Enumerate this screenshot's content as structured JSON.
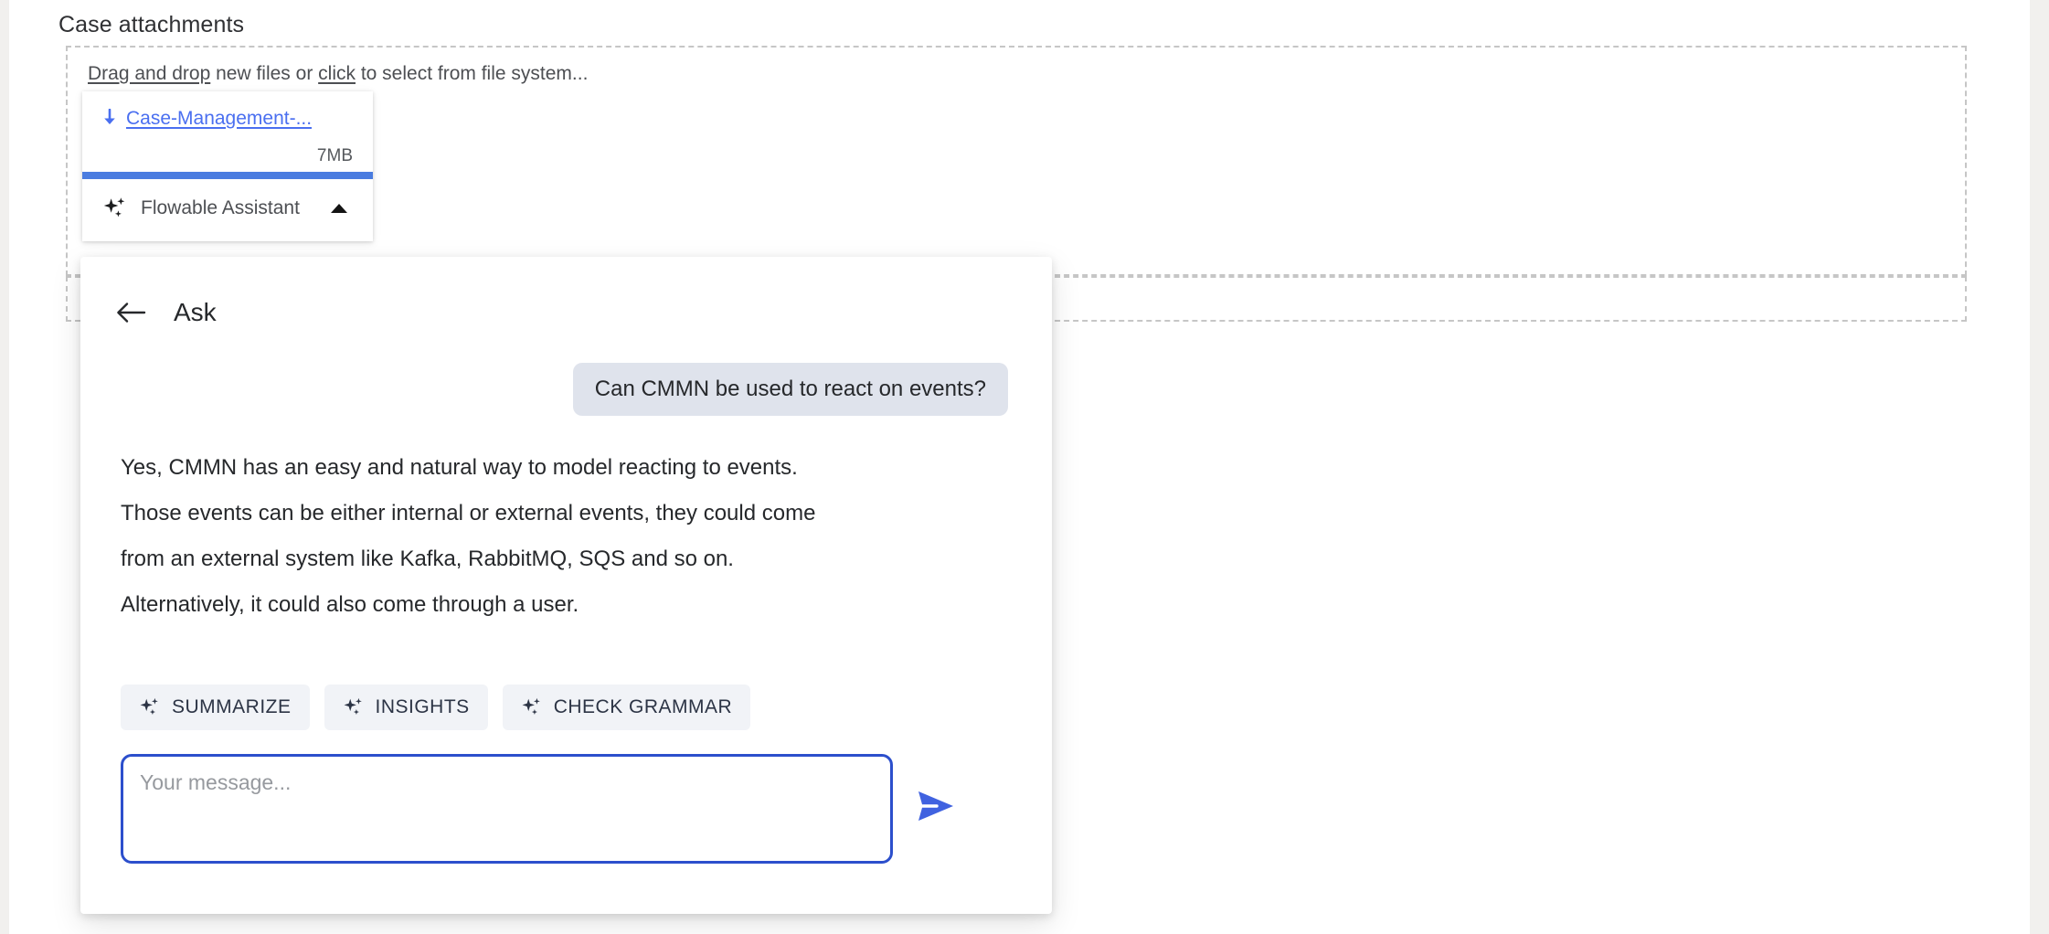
{
  "page": {
    "background_color": "#f1f0ee",
    "panel_color": "#ffffff"
  },
  "attachments": {
    "section_title": "Case attachments",
    "dropzone": {
      "hint_prefix": "Drag and drop",
      "hint_middle": " new files or ",
      "hint_link": "click",
      "hint_suffix": " to select from file system...",
      "border_style": "dashed",
      "border_color": "#c6c6c6"
    },
    "file_card": {
      "download_icon": "download-arrow-icon",
      "file_name": "Case-Management-...",
      "file_size": "7MB",
      "progress_percent": 100,
      "progress_color": "#4a7ce0",
      "link_color": "#4a6ff0"
    },
    "assistant_toggle": {
      "icon": "sparkle-icon",
      "label": "Flowable Assistant",
      "caret": "caret-up-icon",
      "expanded": true
    }
  },
  "chat": {
    "header": {
      "back_icon": "arrow-left-icon",
      "title": "Ask"
    },
    "messages": [
      {
        "role": "user",
        "text": "Can CMMN be used to react on events?",
        "bubble_color": "#dfe3ec"
      },
      {
        "role": "assistant",
        "text": "Yes, CMMN has an easy and natural way to model reacting to events.\nThose events can be either internal or external events, they could come\nfrom an external system like Kafka, RabbitMQ, SQS and so on.\nAlternatively, it could also come through a user."
      }
    ],
    "quick_actions": [
      {
        "icon": "sparkle-icon",
        "label": "SUMMARIZE"
      },
      {
        "icon": "sparkle-icon",
        "label": "INSIGHTS"
      },
      {
        "icon": "sparkle-icon",
        "label": "CHECK GRAMMAR"
      }
    ],
    "composer": {
      "value": "",
      "placeholder": "Your message...",
      "focused": true,
      "focus_border_color": "#2c4fcc",
      "send_icon": "send-icon",
      "send_icon_color": "#4062e0"
    }
  }
}
